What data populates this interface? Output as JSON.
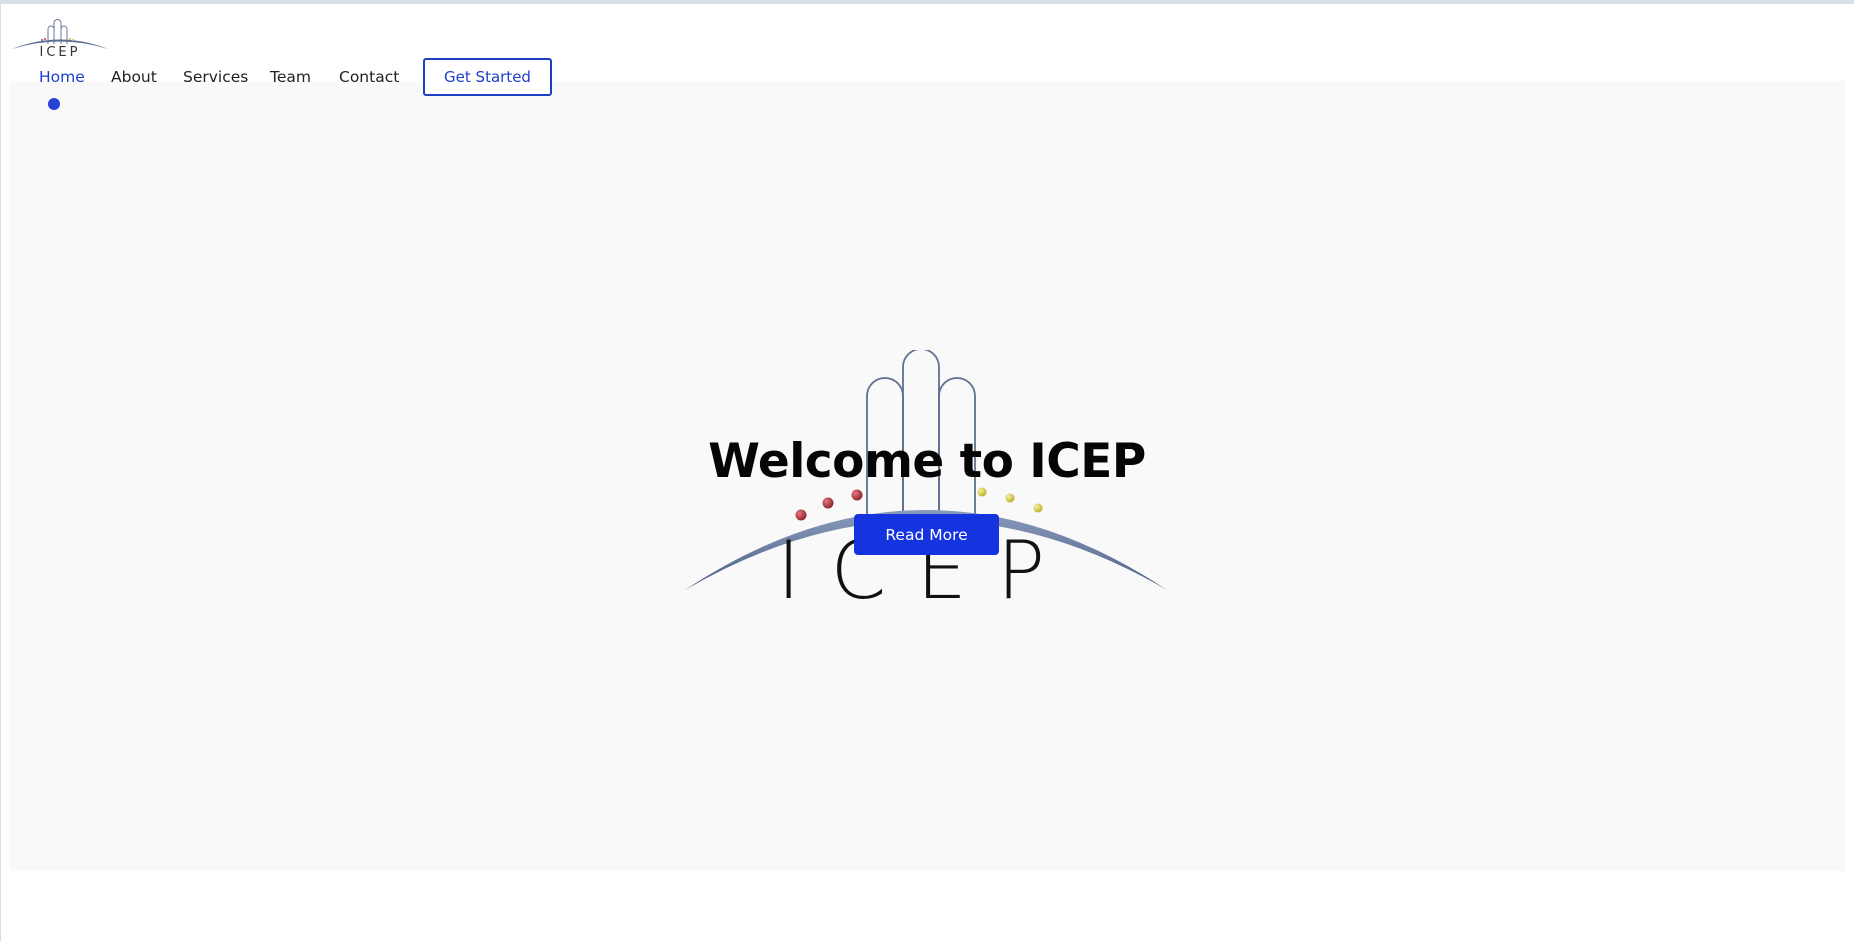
{
  "header": {
    "logo_text": "ICEP"
  },
  "nav": {
    "items": [
      {
        "label": "Home",
        "active": true
      },
      {
        "label": "About",
        "active": false
      },
      {
        "label": "Services",
        "active": false
      },
      {
        "label": "Team",
        "active": false
      },
      {
        "label": "Contact",
        "active": false
      }
    ],
    "cta_label": "Get Started"
  },
  "hero": {
    "title": "Welcome to ICEP",
    "button_label": "Read More",
    "logo_text": "ICEP"
  },
  "colors": {
    "accent": "#1d3ec7",
    "button": "#1534e0",
    "hero_bg": "#f9f9f9"
  }
}
